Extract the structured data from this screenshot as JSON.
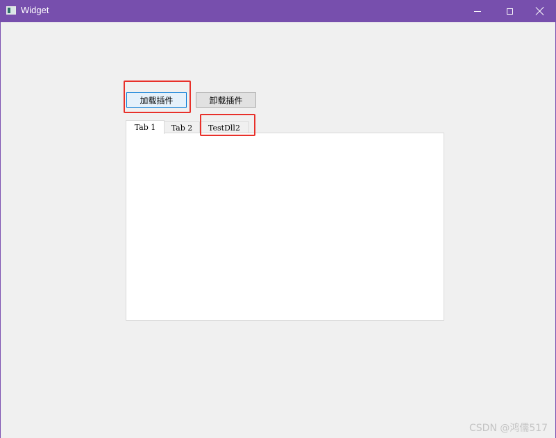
{
  "window": {
    "title": "Widget",
    "accent_color": "#774fad"
  },
  "titlebar": {
    "icons": [
      "app-icon",
      "minimize-icon",
      "maximize-icon",
      "close-icon"
    ]
  },
  "buttons": {
    "load_label": "加载插件",
    "unload_label": "卸载插件"
  },
  "tabs": [
    {
      "label": "Tab 1",
      "selected": true
    },
    {
      "label": "Tab 2",
      "selected": false
    },
    {
      "label": "TestDll2",
      "selected": false
    }
  ],
  "annotations": {
    "highlight_color": "#e8302a"
  },
  "watermark": "CSDN @鸿儒517"
}
